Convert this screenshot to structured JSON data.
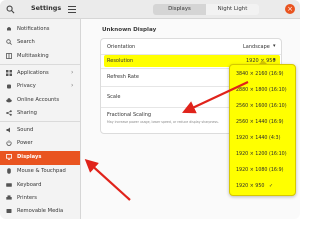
{
  "header": {
    "app_title": "Settings",
    "tabs": [
      {
        "label": "Displays",
        "active": true
      },
      {
        "label": "Night Light",
        "active": false
      }
    ]
  },
  "sidebar": {
    "items": [
      {
        "label": "Notifications",
        "icon": "bell-icon"
      },
      {
        "label": "Search",
        "icon": "search-icon"
      },
      {
        "label": "Multitasking",
        "icon": "multitasking-icon"
      },
      {
        "label": "Applications",
        "icon": "apps-grid-icon",
        "chevron": true
      },
      {
        "label": "Privacy",
        "icon": "hand-icon",
        "chevron": true
      },
      {
        "label": "Online Accounts",
        "icon": "cloud-icon"
      },
      {
        "label": "Sharing",
        "icon": "share-icon"
      },
      {
        "label": "Sound",
        "icon": "speaker-icon"
      },
      {
        "label": "Power",
        "icon": "power-icon"
      },
      {
        "label": "Displays",
        "icon": "display-icon",
        "active": true
      },
      {
        "label": "Mouse & Touchpad",
        "icon": "mouse-icon"
      },
      {
        "label": "Keyboard",
        "icon": "keyboard-icon"
      },
      {
        "label": "Printers",
        "icon": "printer-icon"
      },
      {
        "label": "Removable Media",
        "icon": "media-icon"
      }
    ]
  },
  "main": {
    "section_title": "Unknown Display",
    "orientation": {
      "label": "Orientation",
      "value": "Landscape"
    },
    "resolution": {
      "label": "Resolution",
      "value": "1920 × 950"
    },
    "refresh_rate": {
      "label": "Refresh Rate"
    },
    "scale": {
      "label": "Scale"
    },
    "fractional_scaling": {
      "label": "Fractional Scaling",
      "description": "May increase power usage, lower speed, or reduce display sharpness."
    }
  },
  "resolution_menu": {
    "options": [
      "3840 × 2160 (16:9)",
      "2880 × 1800 (16:10)",
      "2560 × 1600 (16:10)",
      "2560 × 1440 (16:9)",
      "1920 × 1440 (4:3)",
      "1920 × 1200 (16:10)",
      "1920 × 1080 (16:9)",
      "1920 × 950"
    ],
    "selected_index": 7
  },
  "colors": {
    "accent": "#e95420",
    "highlight": "#ffff00",
    "arrow": "#e0231b"
  }
}
